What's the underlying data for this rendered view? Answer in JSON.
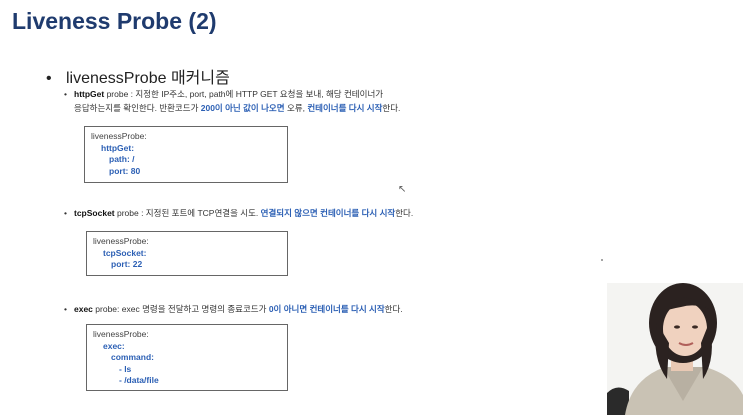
{
  "slide": {
    "title": "Liveness Probe (2)",
    "main_bullet": "livenessProbe 매커니즘",
    "sections": [
      {
        "keyword": "httpGet",
        "line1_rest": " probe : 지정한 IP주소, port, path에 HTTP GET 요청을 보내, 해당 컨테이너가",
        "line2_pre": "응답하는지를 확인한다. 반환코드가 ",
        "line2_blue1": "200이 아닌 값이 나오면",
        "line2_mid": " 오류, ",
        "line2_blue2": "컨테이너를 다시 시작",
        "line2_end": "한다.",
        "code": [
          "livenessProbe:",
          "httpGet:",
          "path: /",
          "port: 80"
        ]
      },
      {
        "keyword": "tcpSocket",
        "line1_rest": " probe : 지정된 포트에 TCP연결을 시도. ",
        "line1_blue1": "연결되지 않으면",
        "line1_space": " ",
        "line1_blue2": "컨테이너를 다시 시작",
        "line1_end": "한다.",
        "code": [
          "livenessProbe:",
          "tcpSocket:",
          "port: 22"
        ]
      },
      {
        "keyword": "exec",
        "line1_rest": " probe: exec 명령을 전달하고 명령의 종료코드가 ",
        "line1_blue1": "0이 아니면",
        "line1_space": " ",
        "line1_blue2": "컨테이너를 다시 시작",
        "line1_end": "한다.",
        "code": [
          "livenessProbe:",
          "exec:",
          "command:",
          "- ls",
          "- /data/file"
        ]
      }
    ]
  },
  "icons": {
    "bullet": "•",
    "cursor": "↖"
  },
  "colors": {
    "title": "#1f3b6e",
    "accent": "#2b5fb4"
  }
}
